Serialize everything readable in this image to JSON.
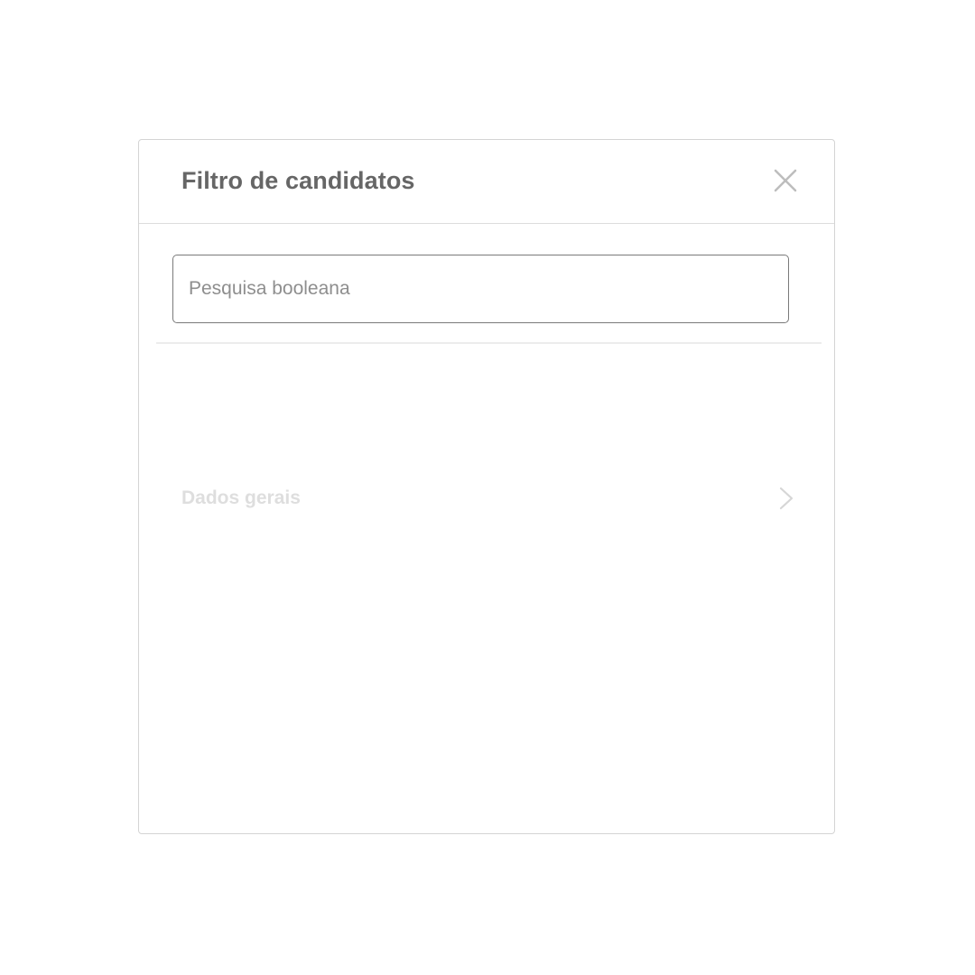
{
  "modal": {
    "title": "Filtro de candidatos",
    "close_icon": "close-icon"
  },
  "search": {
    "placeholder": "Pesquisa booleana",
    "value": ""
  },
  "sections": [
    {
      "label": "Dados gerais",
      "icon": "chevron-right-icon"
    }
  ],
  "colors": {
    "title": "#666666",
    "border": "#d4d4d4",
    "input_border": "#7a7a7a",
    "section_label": "#dedede"
  }
}
